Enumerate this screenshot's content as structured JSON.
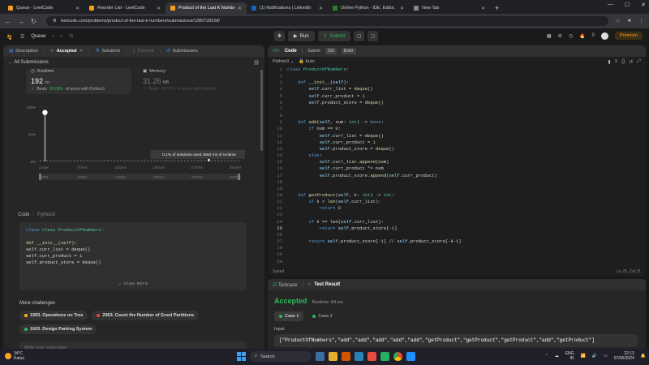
{
  "browser": {
    "tabs": [
      {
        "label": "Queue - LeetCode",
        "color": "#f89f1b",
        "active": false
      },
      {
        "label": "Reorder List - LeetCode",
        "color": "#f89f1b",
        "active": false
      },
      {
        "label": "Product of the Last K Numbers",
        "color": "#f89f1b",
        "active": true
      },
      {
        "label": "(1) Notifications | LinkedIn",
        "color": "#0a66c2",
        "active": false
      },
      {
        "label": "Online Python - IDE, Editor, Co",
        "color": "#2e7d32",
        "active": false
      },
      {
        "label": "New Tab",
        "color": "#888888",
        "active": false
      }
    ],
    "url": "leetcode.com/problems/product-of-the-last-k-numbers/submissions/1280728228/"
  },
  "lcnav": {
    "problem_list": "Queue",
    "run_label": "Run",
    "submit_label": "Submit",
    "streak": "0",
    "premium_label": "Premium"
  },
  "left": {
    "tabs": {
      "description": "Description",
      "accepted": "Accepted",
      "solutions": "Solutions",
      "editorial": "Editorial",
      "submissions": "Submissions"
    },
    "all_submissions": "All Submissions",
    "runtime": {
      "label": "Runtime",
      "value": "192",
      "unit": "ms",
      "beats_prefix": "Beats",
      "beats_pct": "59.09%",
      "beats_suffix": "of users with Python3"
    },
    "memory": {
      "label": "Memory",
      "value": "31.26",
      "unit": "MB",
      "beats_prefix": "Beats",
      "beats_pct": "50.97%",
      "beats_suffix": "of users with Python3"
    },
    "code_header": {
      "label": "Code",
      "lang": "Python3"
    },
    "code_preview": [
      "class ProductOfNumbers:",
      "",
      "    def __init__(self):",
      "        self.curr_list = deque()",
      "        self.curr_product = 1",
      "        self.product_store = deque()"
    ],
    "view_more": "View more",
    "more_challenges_title": "More challenges",
    "challenges": [
      {
        "label": "1993. Operations on Tree",
        "color": "#ffb800"
      },
      {
        "label": "2963. Count the Number of Good Partitions",
        "color": "#ef4743"
      },
      {
        "label": "1603. Design Parking System",
        "color": "#2cbb5d"
      }
    ],
    "notes_placeholder": "Write your notes here"
  },
  "chart_data": {
    "type": "bar",
    "y_ticks": [
      "100%",
      "50%",
      "0%"
    ],
    "x_ticks": [
      "104ms",
      "783ms",
      "1332ms",
      "1901ms",
      "2470ms",
      "3040ms"
    ],
    "range_ticks": [
      "104ms",
      "783ms",
      "1332ms",
      "1901ms",
      "2470ms",
      "3040ms"
    ],
    "tooltip": "0.1% of solutions used 2584 ms of runtime",
    "xlim": [
      104,
      3040
    ],
    "ylim": [
      0,
      100
    ],
    "user_point": {
      "x": 192,
      "y": 90
    },
    "highlight_x": 2584,
    "bar_count": 60
  },
  "editor": {
    "tab_label": "Code",
    "submit_hint": "Submit",
    "kbd1": "Ctrl",
    "kbd2": "Enter",
    "language": "Python3",
    "mode": "Auto",
    "status_left": "Saved",
    "status_right": "Ln 25, Col 31",
    "current_line": 25
  },
  "test": {
    "testcase_tab": "Testcase",
    "result_tab": "Test Result",
    "status": "Accepted",
    "runtime": "Runtime: 84 ms",
    "case1": "Case 1",
    "case2": "Case 2",
    "input_label": "Input",
    "input_value": "[\"ProductOfNumbers\",\"add\",\"add\",\"add\",\"add\",\"add\",\"getProduct\",\"getProduct\",\"getProduct\",\"add\",\"getProduct\"]"
  },
  "taskbar": {
    "temp": "34°C",
    "location": "Kabul",
    "search": "Search",
    "lang1": "ENG",
    "lang2": "IN",
    "time": "22:13",
    "date": "07/06/2024"
  }
}
